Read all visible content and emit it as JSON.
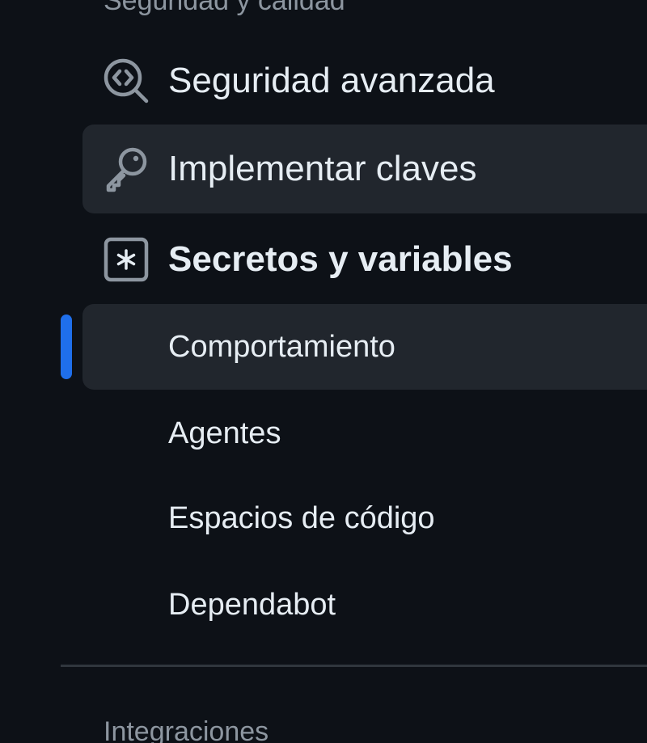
{
  "sidebar": {
    "section_security": "Seguridad y calidad",
    "section_integrations": "Integraciones",
    "items": [
      {
        "label": "Seguridad avanzada",
        "icon": "codescan-icon"
      },
      {
        "label": "Implementar claves",
        "icon": "key-icon"
      },
      {
        "label": "Secretos y variables",
        "icon": "asterisk-box-icon"
      }
    ],
    "sub_items": [
      {
        "label": "Comportamiento",
        "active": true
      },
      {
        "label": "Agentes"
      },
      {
        "label": "Espacios de código"
      },
      {
        "label": "Dependabot"
      }
    ]
  },
  "colors": {
    "background": "#0d1117",
    "highlight": "#21262d",
    "accent": "#1f6feb",
    "text": "#e6edf3",
    "muted": "#8d96a0"
  }
}
